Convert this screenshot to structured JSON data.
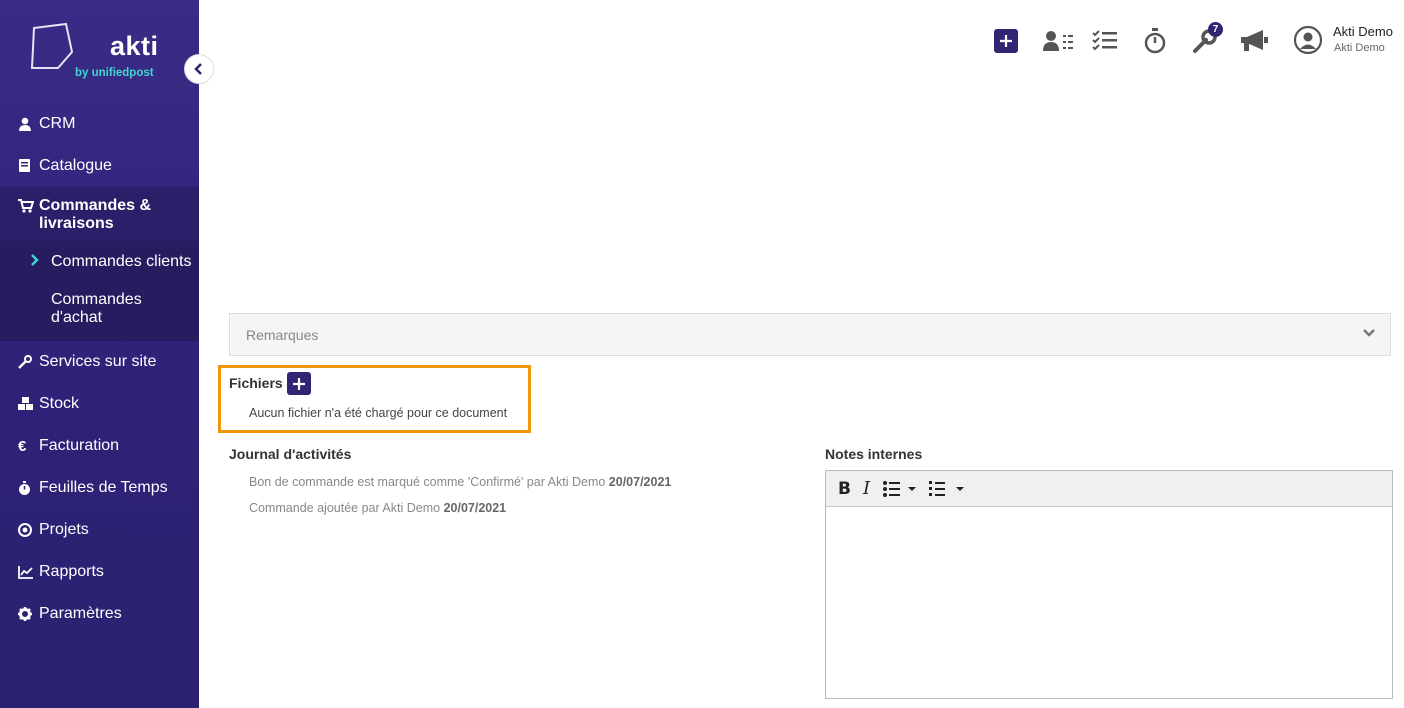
{
  "brand": {
    "name": "akti",
    "tagline": "by unifiedpost",
    "accent_color": "#3fd6d2",
    "primary_color": "#2f2572"
  },
  "sidebar": {
    "items": [
      {
        "label": "CRM",
        "icon": "user-icon"
      },
      {
        "label": "Catalogue",
        "icon": "book-icon"
      },
      {
        "label": "Commandes & livraisons",
        "icon": "cart-icon",
        "expanded": true,
        "children": [
          {
            "label": "Commandes clients",
            "active": true
          },
          {
            "label": "Commandes d'achat",
            "active": false
          }
        ]
      },
      {
        "label": "Services sur site",
        "icon": "wrench-icon"
      },
      {
        "label": "Stock",
        "icon": "boxes-icon"
      },
      {
        "label": "Facturation",
        "icon": "euro-icon"
      },
      {
        "label": "Feuilles de Temps",
        "icon": "stopwatch-icon"
      },
      {
        "label": "Projets",
        "icon": "target-icon"
      },
      {
        "label": "Rapports",
        "icon": "chart-icon"
      },
      {
        "label": "Paramètres",
        "icon": "gear-icon"
      }
    ]
  },
  "header": {
    "notifications_count": "7",
    "user_name": "Akti Demo",
    "user_company": "Akti Demo"
  },
  "remarques": {
    "label": "Remarques"
  },
  "files": {
    "title": "Fichiers",
    "empty_message": "Aucun fichier n'a été chargé pour ce document",
    "highlight_color": "#f0960a"
  },
  "journal": {
    "title": "Journal d'activités",
    "entries": [
      {
        "text": "Bon de commande est marqué comme 'Confirmé' par Akti Demo",
        "date": "20/07/2021"
      },
      {
        "text": "Commande ajoutée par Akti Demo",
        "date": "20/07/2021"
      }
    ]
  },
  "notes": {
    "title": "Notes internes",
    "toolbar": {
      "bold": "B",
      "italic": "I"
    }
  }
}
